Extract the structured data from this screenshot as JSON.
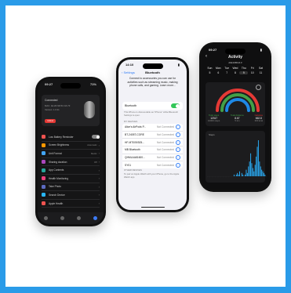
{
  "phone_left": {
    "time": "09:27",
    "battery": "71%",
    "device_status": "Connected",
    "device_mac": "MAC: 1E:2D:9D:5C:0A:7F",
    "device_version": "Version: 1.0.31",
    "badge_label": "Unbind",
    "settings": [
      {
        "label": "Low Battery Reminder",
        "value": "",
        "color": "#ef5350",
        "toggle": true
      },
      {
        "label": "Screen Brightness",
        "value": "Automatic",
        "color": "#ff9800",
        "toggle": false
      },
      {
        "label": "Unit Format",
        "value": "Metric",
        "color": "#42a5f5",
        "toggle": false
      },
      {
        "label": "Sharing duration",
        "value": "Off",
        "color": "#ab47bc",
        "toggle": false
      },
      {
        "label": "App Contents",
        "value": "",
        "color": "#26a69a",
        "toggle": false
      },
      {
        "label": "Health Monitoring",
        "value": "",
        "color": "#ec407a",
        "toggle": false
      },
      {
        "label": "Take Photo",
        "value": "",
        "color": "#5c6bc0",
        "toggle": false
      },
      {
        "label": "Search Device",
        "value": "",
        "color": "#29b6f6",
        "toggle": false
      },
      {
        "label": "Apple Health",
        "value": "",
        "color": "#ef5350",
        "toggle": false
      }
    ],
    "tab_colors": [
      "#666666",
      "#666666",
      "#666666",
      "#3d7bf5"
    ]
  },
  "phone_mid": {
    "time": "14:10",
    "back_label": "Settings",
    "title": "Bluetooth",
    "intro": "Connect to accessories you can use for activities such as streaming music, making phone calls, and gaming. Learn more...",
    "bluetooth_label": "Bluetooth",
    "discoverable_note": "This iPhone is discoverable as \"iPhone\" while Bluetooth Settings is open.",
    "my_devices_header": "MY DEVICES",
    "devices": [
      {
        "name": "Alice's AirPods P...",
        "status": "Not Connected"
      },
      {
        "name": "BT-2405T-CORE",
        "status": "Not Connected"
      },
      {
        "name": "HF-MT009/305...",
        "status": "Not Connected"
      },
      {
        "name": "MB Bluetooth",
        "status": "Not Connected"
      },
      {
        "name": "QHMLAA81600...",
        "status": "Not Connected"
      },
      {
        "name": "SY01",
        "status": "Not Connected"
      }
    ],
    "other_header": "OTHER DEVICES",
    "other_note": "To pair an Apple Watch with your iPhone, go to the Apple Watch app."
  },
  "phone_right": {
    "time": "09:27",
    "title": "Activity",
    "date": "2024/05/16",
    "weekdays": [
      "Sun",
      "Mon",
      "Tue",
      "Wed",
      "Thu",
      "Fri",
      "Sat"
    ],
    "dates": [
      "5",
      "6",
      "7",
      "8",
      "9",
      "10",
      "11"
    ],
    "selected_index": 4,
    "ring_colors": [
      "#e53935",
      "#43a047",
      "#1e88e5"
    ],
    "stats": [
      {
        "label": "Total steps",
        "value": "12317",
        "target": "10000 steps",
        "color": "#43a047"
      },
      {
        "label": "Total distance",
        "value": "8.67",
        "target": "5 km",
        "color": "#43a047"
      },
      {
        "label": "Calories",
        "value": "662.8",
        "target": "300 kcal",
        "color": "#e53935"
      }
    ],
    "chart_label": "Steps",
    "bars": [
      0,
      0,
      0,
      0,
      0,
      0,
      0,
      0,
      0,
      0,
      0,
      0,
      0,
      0,
      0,
      0,
      0,
      0,
      0,
      0,
      0,
      0,
      0,
      0,
      1,
      0,
      1,
      2,
      1,
      3,
      0,
      2,
      1,
      0,
      1,
      4,
      2,
      6,
      9,
      14,
      8,
      5,
      3,
      7,
      12,
      18,
      22,
      9,
      6,
      4,
      3,
      2,
      1,
      0
    ]
  }
}
